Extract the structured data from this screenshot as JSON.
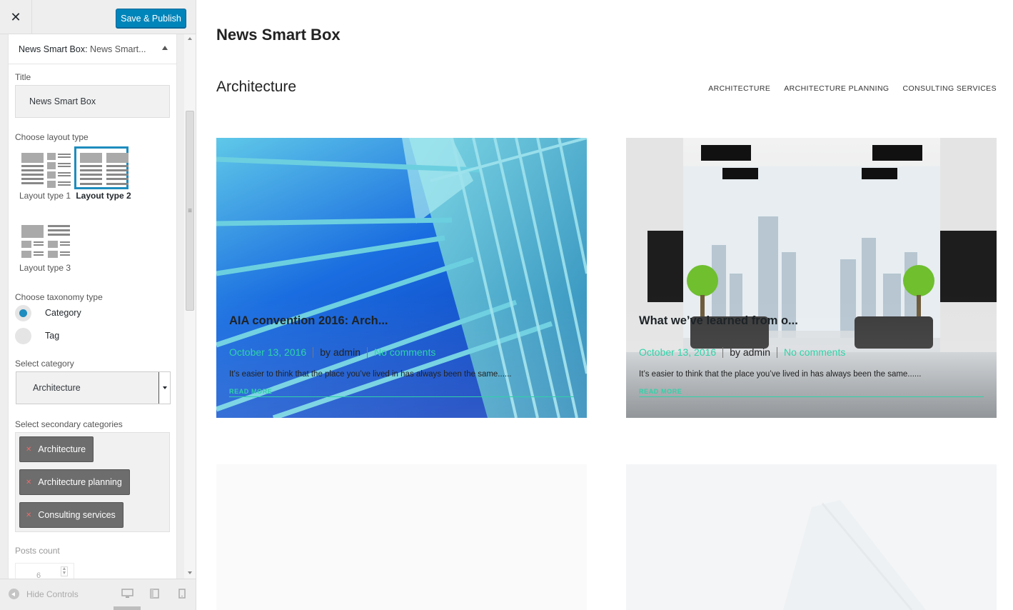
{
  "sidebar": {
    "close_icon": "close-icon",
    "publish_label": "Save & Publish",
    "widget": {
      "title": "News Smart Box:",
      "subtitle": "News Smart..."
    },
    "fields": {
      "title_label": "Title",
      "title_value": "News Smart Box",
      "layout_label": "Choose layout type",
      "layouts": [
        {
          "label": "Layout type 1",
          "selected": false
        },
        {
          "label": "Layout type 2",
          "selected": true
        },
        {
          "label": "Layout type 3",
          "selected": false
        }
      ],
      "taxonomy_label": "Choose taxonomy type",
      "taxonomy_options": [
        {
          "label": "Category",
          "checked": true
        },
        {
          "label": "Tag",
          "checked": false
        }
      ],
      "category_label": "Select category",
      "category_value": "Architecture",
      "secondary_label": "Select secondary categories",
      "secondary_tags": [
        "Architecture",
        "Architecture planning",
        "Consulting services"
      ],
      "posts_count_label": "Posts count",
      "posts_count_value": "6"
    },
    "footer": {
      "hide_controls": "Hide Controls"
    }
  },
  "preview": {
    "widget_title": "News Smart Box",
    "block_title": "Architecture",
    "nav": [
      "ARCHITECTURE",
      "ARCHITECTURE PLANNING",
      "CONSULTING SERVICES"
    ],
    "posts": [
      {
        "title": "AIA convention 2016: Arch...",
        "date": "October 13, 2016",
        "author": "by admin",
        "comments": "No comments",
        "excerpt": "It’s easier to think that the place you’ve lived in has always been the same......",
        "read_more": "READ MORE"
      },
      {
        "title": "What we’ve learned from o...",
        "date": "October 13, 2016",
        "author": "by admin",
        "comments": "No comments",
        "excerpt": "It’s easier to think that the place you’ve lived in has always been the same......",
        "read_more": "READ MORE"
      }
    ]
  },
  "colors": {
    "publish": "#0085ba",
    "accent": "#2fd3a8",
    "selected_border": "#1e8cbe",
    "tag_bg": "#6d6d6d"
  }
}
